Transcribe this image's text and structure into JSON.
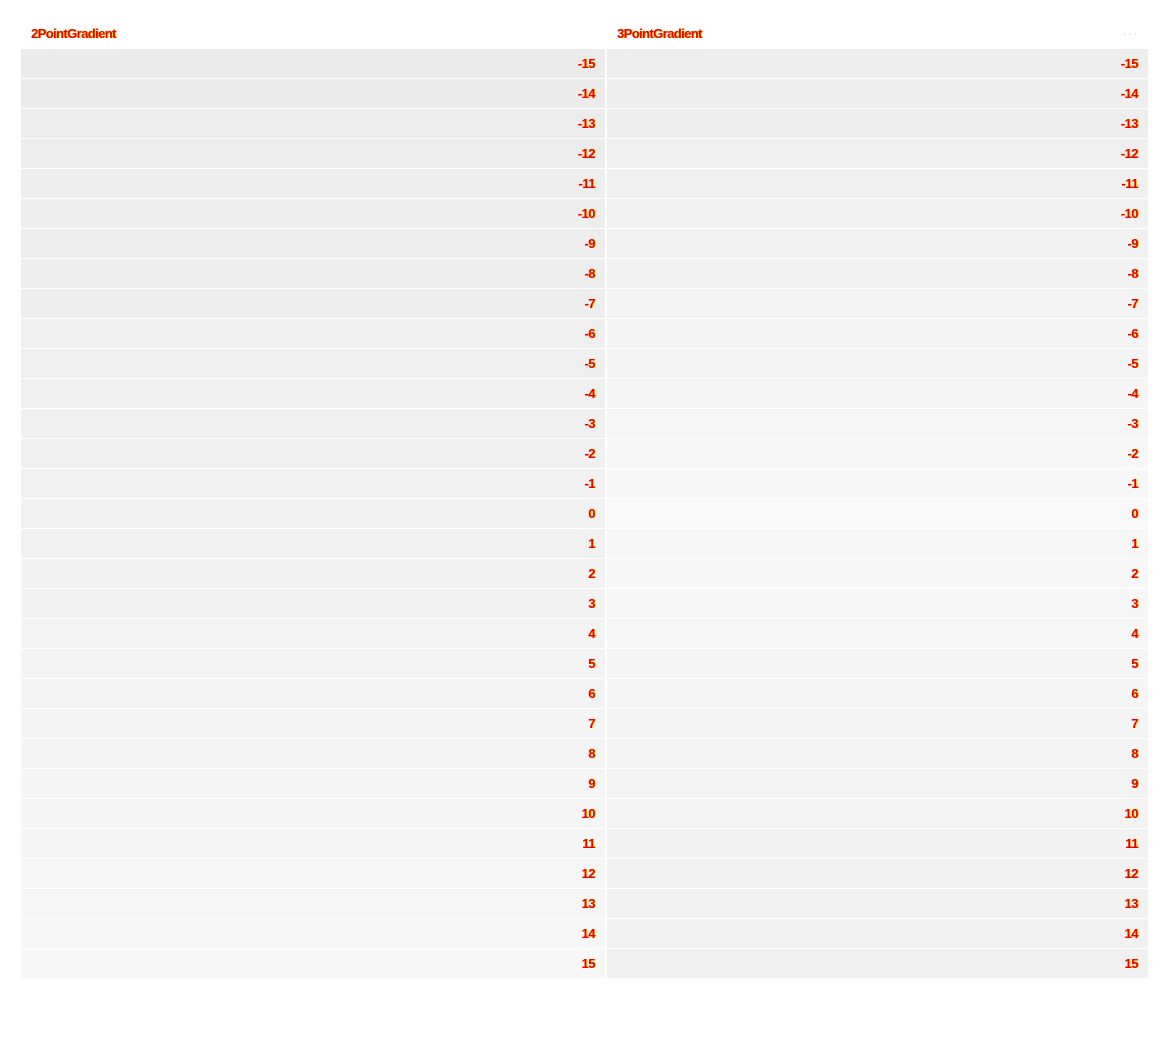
{
  "panels": [
    {
      "id": "left",
      "title": "2PointGradient",
      "menu_label": "",
      "gradient": {
        "start_color": "#ebebeb",
        "end_color": "#f7f7f7",
        "mid_color": null
      },
      "values": [
        "-15",
        "-14",
        "-13",
        "-12",
        "-11",
        "-10",
        "-9",
        "-8",
        "-7",
        "-6",
        "-5",
        "-4",
        "-3",
        "-2",
        "-1",
        "0",
        "1",
        "2",
        "3",
        "4",
        "5",
        "6",
        "7",
        "8",
        "9",
        "10",
        "11",
        "12",
        "13",
        "14",
        "15"
      ]
    },
    {
      "id": "right",
      "title": "3PointGradient",
      "menu_label": "···",
      "gradient": {
        "start_color": "#ededed",
        "end_color": "#f0f0f0",
        "mid_color": "#f8f8f8"
      },
      "values": [
        "-15",
        "-14",
        "-13",
        "-12",
        "-11",
        "-10",
        "-9",
        "-8",
        "-7",
        "-6",
        "-5",
        "-4",
        "-3",
        "-2",
        "-1",
        "0",
        "1",
        "2",
        "3",
        "4",
        "5",
        "6",
        "7",
        "8",
        "9",
        "10",
        "11",
        "12",
        "13",
        "14",
        "15"
      ]
    }
  ],
  "text_colors": {
    "primary": "#e60000",
    "glow": "#ffd000"
  }
}
